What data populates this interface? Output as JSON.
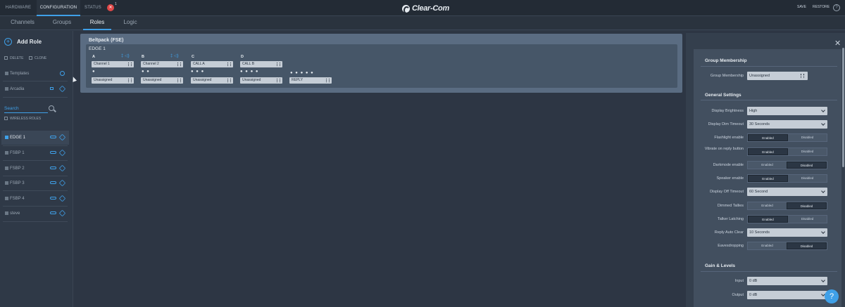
{
  "top_tabs": [
    "HARDWARE",
    "CONFIGURATION",
    "STATUS"
  ],
  "status_badge": "✕",
  "status_count": "1",
  "logo_text": "Clear-Com",
  "top_actions": {
    "save": "SAVE",
    "restore": "RESTORE",
    "help": "?"
  },
  "sub_tabs": [
    "Channels",
    "Groups",
    "Roles",
    "Logic"
  ],
  "sidebar": {
    "add_role": "Add Role",
    "delete": "DELETE",
    "clone": "CLONE",
    "templates": "Templates",
    "arcadia": "Arcadia",
    "search_placeholder": "Search",
    "wireless_roles": "WIRELESS ROLES",
    "roles": [
      "EDGE 1",
      "FSBP 1",
      "FSBP 2",
      "FSBP 3",
      "FSBP 4",
      "steve"
    ]
  },
  "beltpack": {
    "title": "Beltpack (FSE)",
    "subtitle": "EDGE 1",
    "keys": [
      {
        "letter": "A",
        "value": "Channel 1",
        "icons": "‡ ◁)"
      },
      {
        "letter": "B",
        "value": "Channel 2",
        "icons": "‡ ◁)"
      },
      {
        "letter": "C",
        "value": "CALL A",
        "icons": ""
      },
      {
        "letter": "D",
        "value": "CALL B",
        "icons": ""
      }
    ],
    "row2": [
      {
        "dots": "●",
        "value": "Unassigned"
      },
      {
        "dots": "● ●",
        "value": "Unassigned"
      },
      {
        "dots": "● ● ●",
        "value": "Unassigned"
      },
      {
        "dots": "● ● ● ●",
        "value": "Unassigned"
      },
      {
        "dots": "● ● ● ● ●",
        "value": "REPLY"
      }
    ]
  },
  "panel": {
    "group_membership_title": "Group Membership",
    "group_membership_label": "Group Membership",
    "group_membership_value": "Unassigned",
    "general_title": "General Settings",
    "display_brightness_label": "Display Brightness",
    "display_brightness_value": "High",
    "display_dim_label": "Display Dim Timeout",
    "display_dim_value": "30 Seconds",
    "toggles": [
      {
        "label": "Flashlight enable",
        "on": "Enabled",
        "off": "Disabled",
        "selected": "Enabled"
      },
      {
        "label": "Vibrate on reply button",
        "on": "Enabled",
        "off": "Disabled",
        "selected": "Enabled"
      },
      {
        "label": "Darkmode enable",
        "on": "Enabled",
        "off": "Disabled",
        "selected": "Disabled"
      },
      {
        "label": "Speaker enable",
        "on": "Enabled",
        "off": "Disabled",
        "selected": "Enabled"
      }
    ],
    "display_off_label": "Display Off Timeout",
    "display_off_value": "60 Second",
    "toggles2": [
      {
        "label": "Dimmed Tallies",
        "on": "Enabled",
        "off": "Disabled",
        "selected": "Disabled"
      },
      {
        "label": "Talker Latching",
        "on": "Enabled",
        "off": "Disabled",
        "selected": "Enabled"
      }
    ],
    "reply_auto_label": "Reply Auto Clear",
    "reply_auto_value": "10 Seconds",
    "eaves_label": "Eavesdropping",
    "eaves_on": "Enabled",
    "eaves_off": "Disabled",
    "gain_title": "Gain & Levels",
    "input_label": "Input",
    "input_value": "0 dB",
    "output_label": "Output",
    "output_value": "0 dB"
  }
}
